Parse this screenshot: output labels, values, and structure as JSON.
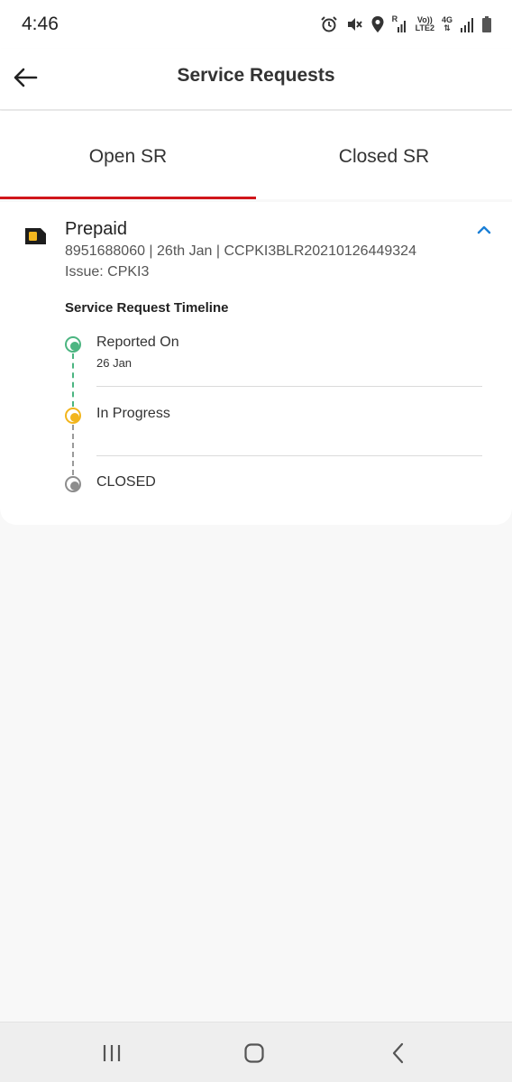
{
  "status_bar": {
    "time": "4:46",
    "icons": [
      "alarm-icon",
      "mute-icon",
      "location-icon",
      "signal-icon",
      "volte-icon",
      "4g-icon",
      "signal-icon",
      "battery-icon"
    ],
    "volte_top": "Vo))",
    "volte_bottom": "LTE2",
    "network": "4G",
    "roaming": "R"
  },
  "header": {
    "title": "Service Requests",
    "back_icon": "arrow-left-icon"
  },
  "tabs": [
    {
      "label": "Open SR",
      "active": true
    },
    {
      "label": "Closed SR",
      "active": false
    }
  ],
  "colors": {
    "accent": "#d0161b",
    "reported": "#4cb581",
    "in_progress": "#f2b51c",
    "closed": "#8d8d8d",
    "link": "#1a7fd6"
  },
  "sr_card": {
    "title": "Prepaid",
    "meta": "8951688060 | 26th Jan | CCPKI3BLR20210126449324",
    "issue": "Issue: CPKI3",
    "timeline_heading": "Service Request Timeline",
    "steps": [
      {
        "label": "Reported On",
        "date": "26 Jan"
      },
      {
        "label": "In Progress",
        "date": ""
      },
      {
        "label": "CLOSED",
        "date": ""
      }
    ]
  },
  "nav": {
    "recent_icon": "recent-apps-icon",
    "home_icon": "home-icon",
    "back_icon": "back-chevron-icon"
  }
}
